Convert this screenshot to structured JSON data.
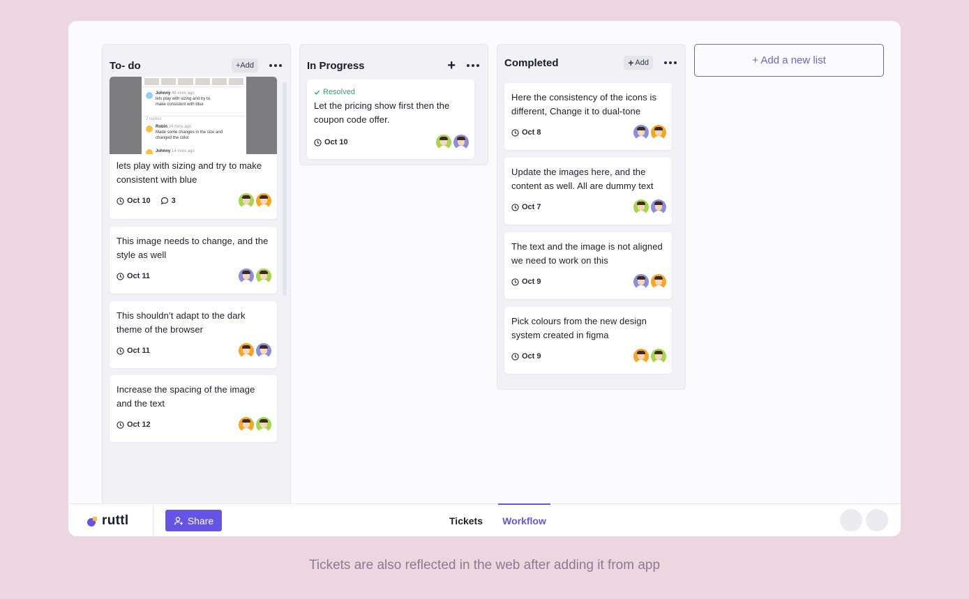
{
  "lists": {
    "todo": {
      "title": "To- do",
      "add_label": "+Add",
      "preview": {
        "comments": [
          {
            "author": "Johnny",
            "time": "46 mins ago",
            "text_line1": "lets play with sizing and try to",
            "text_line2": "make consistent with blue"
          },
          {
            "author": "Robin",
            "time": "24 mins ago",
            "text_line1": "Made some changes in the size and",
            "text_line2": "changed the color"
          },
          {
            "author": "Johnny",
            "time": "14 mins ago"
          }
        ],
        "replies": "2 replies"
      },
      "cards": [
        {
          "text": "lets play with sizing and try to make consistent with blue",
          "date": "Oct 10",
          "comments": "3"
        },
        {
          "text": "This image needs to change, and the style as well",
          "date": "Oct 11"
        },
        {
          "text": "This shouldn’t adapt to the dark theme of the browser",
          "date": "Oct 11"
        },
        {
          "text": "Increase the spacing of the image and the text",
          "date": "Oct 12"
        }
      ]
    },
    "progress": {
      "title": "In Progress",
      "cards": [
        {
          "status": "Resolved",
          "text": "Let the pricing show first then the coupon code offer.",
          "date": "Oct 10"
        }
      ]
    },
    "completed": {
      "title": "Completed",
      "add_label": "Add",
      "cards": [
        {
          "text": "Here the consistency of the icons is different, Change it to dual-tone",
          "date": "Oct 8"
        },
        {
          "text": "Update the images here, and the content as well. All are dummy text",
          "date": "Oct 7"
        },
        {
          "text": "The text and the image is not aligned we need to work on this",
          "date": "Oct 9"
        },
        {
          "text": "Pick colours from the new design system created in figma",
          "date": "Oct 9"
        }
      ]
    }
  },
  "add_list_label": "+ Add a new list",
  "bottom_bar": {
    "logo_text": "ruttl",
    "share_label": "Share",
    "tabs": [
      "Tickets",
      "Workflow"
    ],
    "active_tab": "Workflow"
  },
  "caption": "Tickets are also reflected in the web after adding it from app",
  "colors": {
    "accent": "#6654e6",
    "resolved": "#2fa96b",
    "background": "#ecd6df",
    "avatar_green": "#a6d64a",
    "avatar_orange": "#f5a623",
    "avatar_purple": "#8b8fd8"
  },
  "icons": [
    "clock-icon",
    "comment-icon",
    "check-icon",
    "user-plus-icon",
    "more-icon",
    "plus-icon"
  ]
}
